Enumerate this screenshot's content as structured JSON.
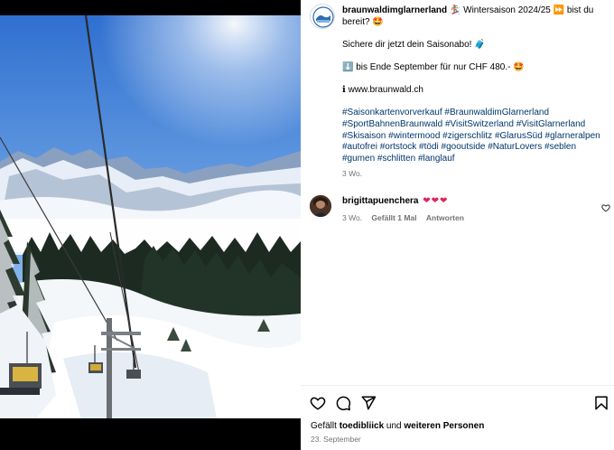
{
  "post": {
    "account": "braunwaldimglarnerland",
    "caption_lines": {
      "line1": " 🏂 Wintersaison 2024/25 ⏩ bist du bereit? 🤩",
      "line2": "Sichere dir jetzt dein Saisonabo! 🧳",
      "line3": "⬇️ bis Ende September für nur CHF 480.- 🤩",
      "line4": "ℹ www.braunwald.ch"
    },
    "hashtags": "#Saisonkartenvorverkauf #BraunwaldimGlarnerland #SportBahnenBraunwald #VisitSwitzerland #VisitGlarnerland #Skisaison #wintermood #zigerschlitz #GlarusSüd #glarneralpen #autofrei #ortstock #tödi #gooutside #NaturLovers #seblen #gumen #schlitten #langlauf",
    "time_ago": "3 Wo."
  },
  "comment": {
    "username": "brigittapuenchera",
    "text": "❤❤❤",
    "time_ago": "3 Wo.",
    "likes": "Gefällt 1 Mal",
    "reply": "Antworten"
  },
  "likes_line": {
    "prefix": "Gefällt",
    "user": "toedibliick",
    "joiner": "und",
    "others": "weiteren Personen"
  },
  "date": "23. September",
  "icons": {
    "like": "heart-icon",
    "comment": "comment-icon",
    "share": "share-icon",
    "save": "bookmark-icon"
  }
}
